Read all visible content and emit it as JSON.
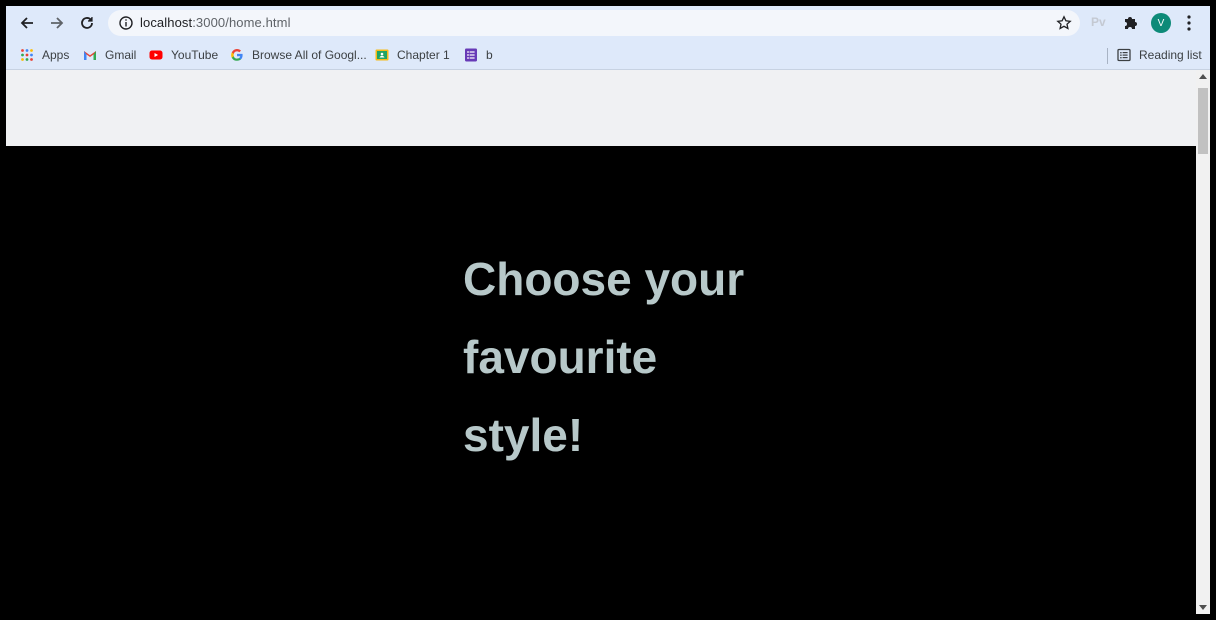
{
  "browser": {
    "url_host": "localhost",
    "url_path": ":3000/home.html",
    "extension_label": "Pv",
    "profile_initial": "V"
  },
  "bookmarks": [
    {
      "label": "Apps",
      "icon": "apps-grid-icon"
    },
    {
      "label": "Gmail",
      "icon": "gmail-icon"
    },
    {
      "label": "YouTube",
      "icon": "youtube-icon"
    },
    {
      "label": "Browse All of Googl...",
      "icon": "google-icon"
    },
    {
      "label": "Chapter 1",
      "icon": "classroom-icon"
    },
    {
      "label": "b",
      "icon": "forms-icon"
    }
  ],
  "reading_list": "Reading list",
  "page": {
    "heading_lines": [
      "Choose your",
      "favourite",
      "style!"
    ]
  },
  "colors": {
    "page_background": "#000000",
    "banner_background": "#f0f1f3",
    "heading": "#b7c8c9",
    "chrome_toolbar": "#dee9fa",
    "profile_avatar": "#0d8a78"
  }
}
